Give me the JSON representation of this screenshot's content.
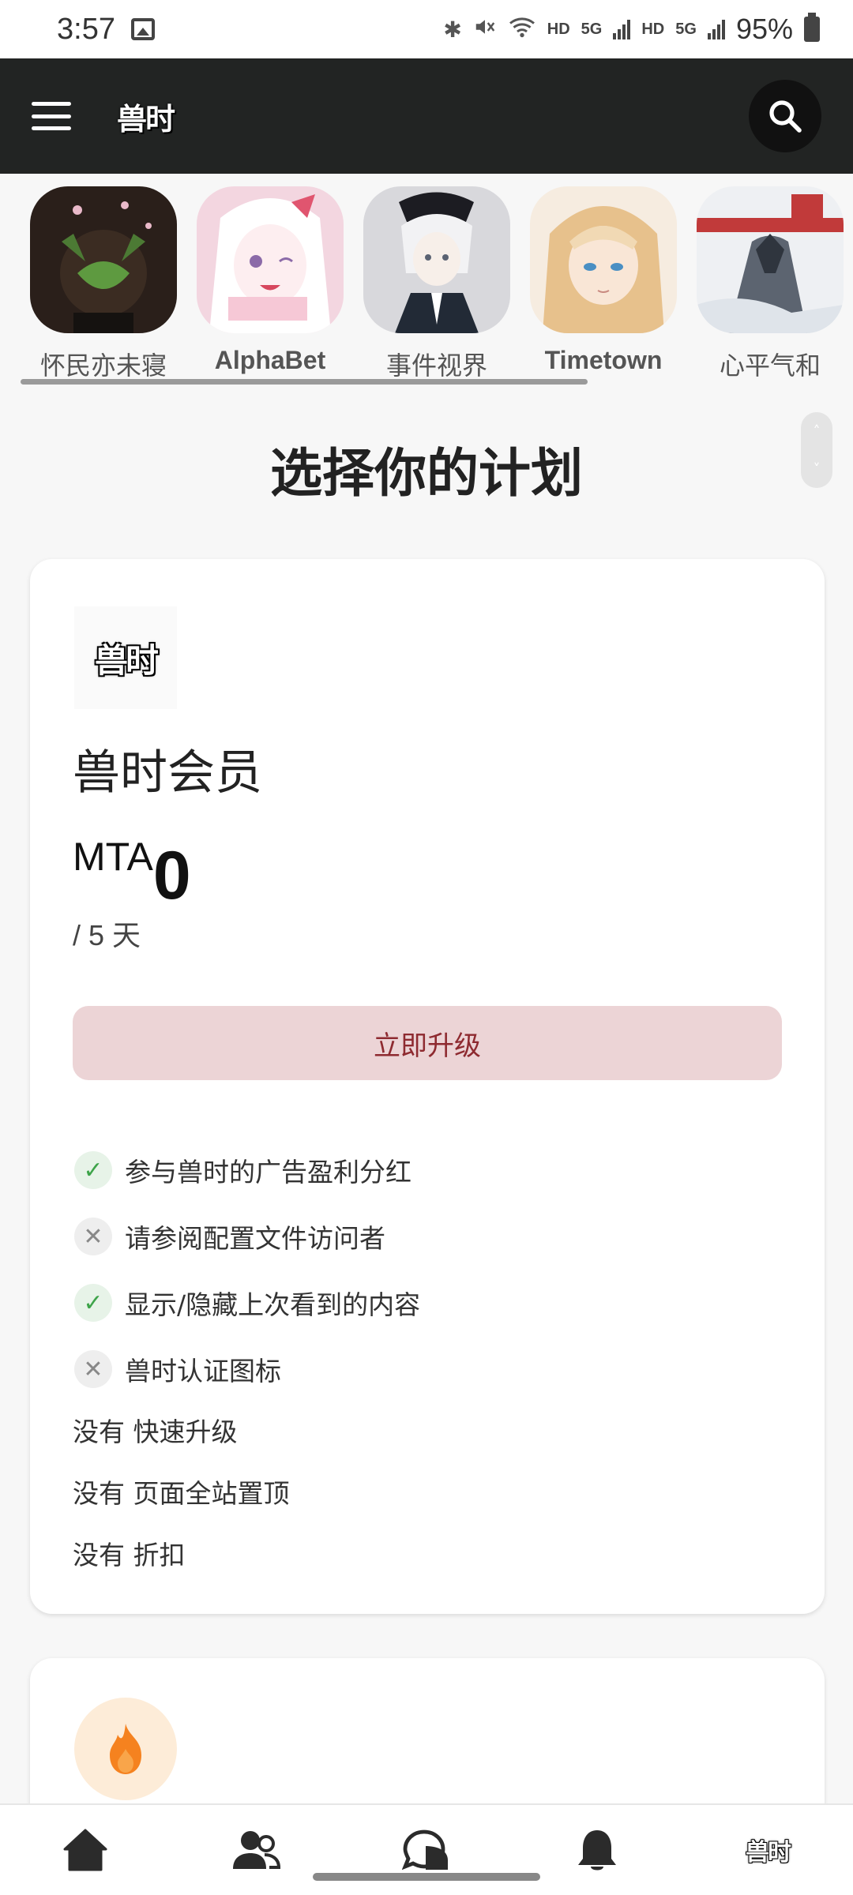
{
  "status_bar": {
    "time": "3:57",
    "hd1": "HD",
    "net1": "5G",
    "hd2": "HD",
    "net2": "5G",
    "battery": "95%"
  },
  "header": {
    "logo_text": "兽时",
    "icons": {
      "menu": "hamburger-icon",
      "search": "search-icon"
    }
  },
  "stories": [
    {
      "name": "怀民亦未寝",
      "palette": [
        "#2a1f1a",
        "#4c7a34"
      ]
    },
    {
      "name": "AlphaBet",
      "palette": [
        "#f3d6e0",
        "#ffffff"
      ]
    },
    {
      "name": "事件视界",
      "palette": [
        "#d8d8dc",
        "#222a36"
      ]
    },
    {
      "name": "Timetown",
      "palette": [
        "#f1d9b4",
        "#e7c18c"
      ]
    },
    {
      "name": "心平气和",
      "palette": [
        "#eef0f3",
        "#c13a3a"
      ]
    }
  ],
  "page": {
    "title": "选择你的计划",
    "scroll_up": "˄",
    "scroll_down": "˅"
  },
  "plan": {
    "logo_text": "兽时",
    "name": "兽时会员",
    "currency": "MTA",
    "amount": "0",
    "period": "/ 5 天",
    "upgrade_label": "立即升级",
    "features": [
      {
        "text": "参与兽时的广告盈利分红",
        "included": true
      },
      {
        "text": "请参阅配置文件访问者",
        "included": false
      },
      {
        "text": "显示/隐藏上次看到的内容",
        "included": true
      },
      {
        "text": "兽时认证图标",
        "included": false
      }
    ],
    "plain_features": [
      "没有 快速升级",
      "没有 页面全站置顶",
      "没有 折扣"
    ],
    "check_glyph": "✓",
    "cross_glyph": "✕"
  },
  "bottom_nav": {
    "items": [
      "home-icon",
      "friends-icon",
      "messages-icon",
      "notifications-icon",
      "brand-logo"
    ],
    "logo_text": "兽时"
  },
  "colors": {
    "header_bg": "#222423",
    "upgrade_bg": "#ecd4d6",
    "upgrade_text": "#8e2a30",
    "check_green": "#3ea44a",
    "fire_orange": "#f5821f"
  }
}
